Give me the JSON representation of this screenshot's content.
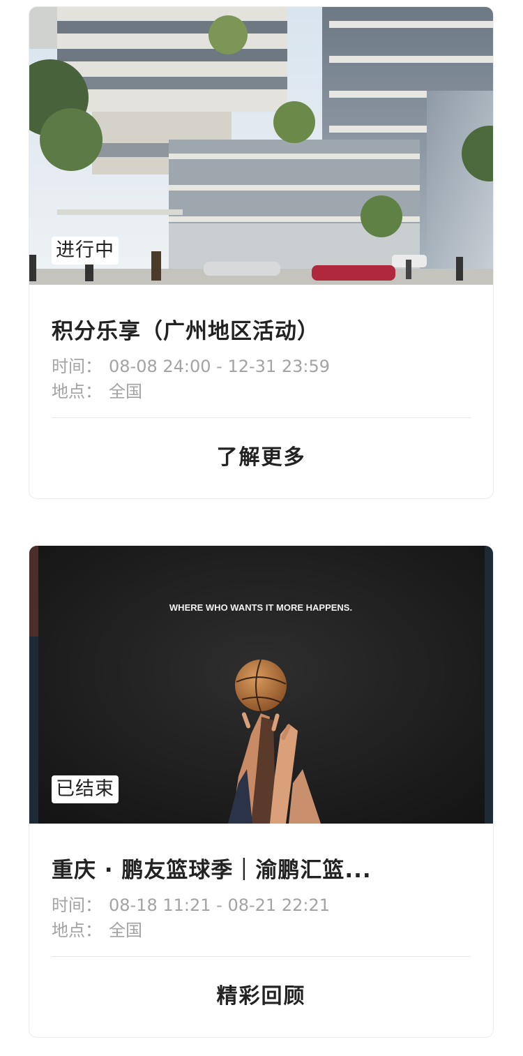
{
  "activities": [
    {
      "status": "进行中",
      "title": "积分乐享（广州地区活动）",
      "time_label": "时间：",
      "time_value": "08-08 24:00 - 12-31 23:59",
      "location_label": "地点：",
      "location_value": "全国",
      "action_label": "了解更多",
      "image": "modern-office-building-photo"
    },
    {
      "status": "已结束",
      "title": "重庆 · 鹏友篮球季｜渝鹏汇篮...",
      "time_label": "时间：",
      "time_value": "08-18 11:21 - 08-21 22:21",
      "location_label": "地点：",
      "location_value": "全国",
      "action_label": "精彩回顾",
      "image": "basketball-jump-ball-poster",
      "poster_text": "WHERE WHO WANTS IT MORE HAPPENS."
    }
  ]
}
